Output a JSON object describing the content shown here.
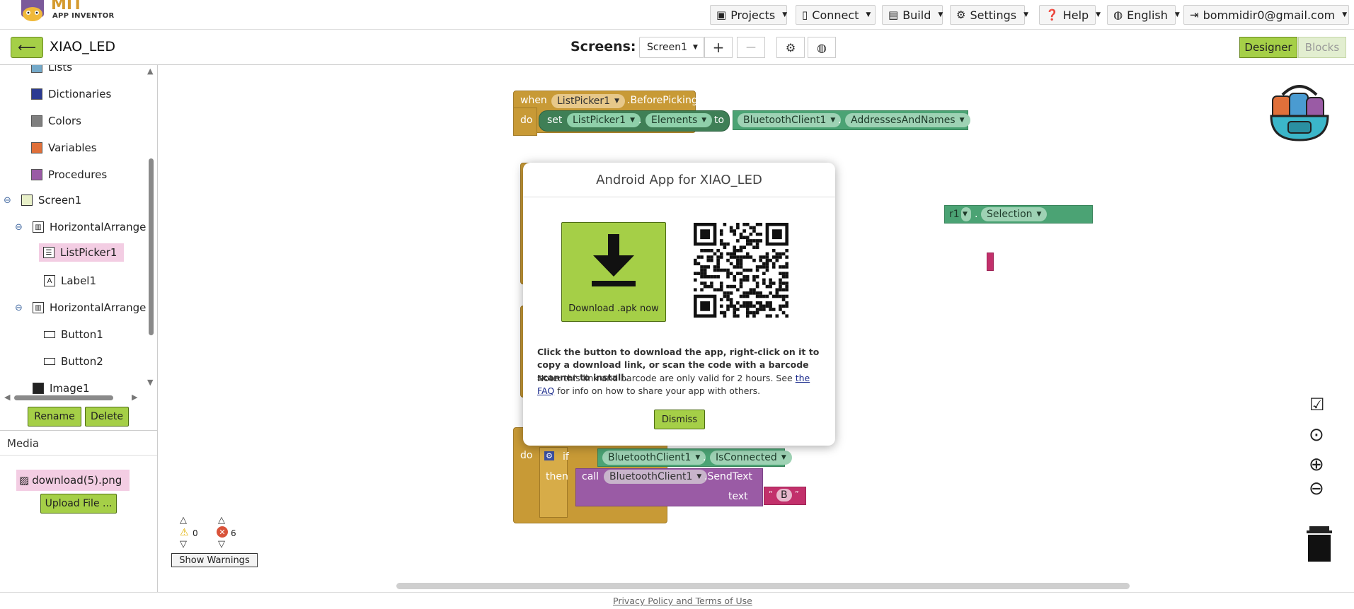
{
  "header": {
    "logo_main": "MIT",
    "logo_sub": "APP INVENTOR",
    "menu": [
      {
        "label": "Projects",
        "icon": "folder-icon"
      },
      {
        "label": "Connect",
        "icon": "phone-icon"
      },
      {
        "label": "Build",
        "icon": "build-icon"
      },
      {
        "label": "Settings",
        "icon": "gear-icon"
      },
      {
        "label": "Help",
        "icon": "help-icon"
      },
      {
        "label": "English",
        "icon": "globe-icon"
      },
      {
        "label": "bommidir0@gmail.com",
        "icon": "logout-icon"
      }
    ]
  },
  "projectbar": {
    "project_name": "XIAO_LED",
    "screens_label": "Screens:",
    "screen_selected": "Screen1",
    "add_screen": "+",
    "remove_screen": "—",
    "designer_label": "Designer",
    "blocks_label": "Blocks"
  },
  "tree": {
    "lists": "Lists",
    "dictionaries": "Dictionaries",
    "colors": "Colors",
    "variables": "Variables",
    "procedures": "Procedures",
    "screen1": "Screen1",
    "harr1": "HorizontalArrangem",
    "listpicker1": "ListPicker1",
    "label1": "Label1",
    "harr2": "HorizontalArrangem",
    "button1": "Button1",
    "button2": "Button2",
    "image1": "Image1",
    "swatch_colors": {
      "lists": "#74a9c9",
      "dictionaries": "#2b3a91",
      "colors": "#7f7f7f",
      "variables": "#e0703a",
      "procedures": "#9a5ba5"
    }
  },
  "left_buttons": {
    "rename": "Rename",
    "delete": "Delete"
  },
  "media": {
    "heading": "Media",
    "file": "download(5).png",
    "upload": "Upload File ..."
  },
  "blocks": {
    "when": "when",
    "do": "do",
    "listpicker": "ListPicker1",
    "before_picking": ".BeforePicking",
    "set": "set",
    "elements": "Elements",
    "to": "to",
    "bt_client": "BluetoothClient1",
    "addresses": "AddressesAndNames",
    "selection_prefix": "r1",
    "selection": "Selection",
    "if": "if",
    "then": "then",
    "is_connected": "IsConnected",
    "call": "call",
    "send_text": ".SendText",
    "text": "text",
    "text_value": "B",
    "dot": "."
  },
  "modal": {
    "title": "Android App for XIAO_LED",
    "download_label": "Download .apk now",
    "instruction": "Click the button to download the app, right-click on it to copy a download link, or scan the code with a barcode scanner to install.",
    "note_before": "Note: this link and barcode are only valid for 2 hours. See ",
    "faq_link": "the FAQ",
    "note_after": " for info on how to share your app with others.",
    "dismiss": "Dismiss"
  },
  "warnings": {
    "warning_count": "0",
    "error_count": "6",
    "show_warnings": "Show Warnings"
  },
  "footer": {
    "privacy": "Privacy Policy and Terms of Use"
  },
  "colors": {
    "accent_green": "#a5cf47",
    "event_gold": "#c89a36",
    "bluetooth_green": "#4ba374",
    "procedure_purple": "#9a5ba5",
    "text_magenta": "#c2306b"
  }
}
